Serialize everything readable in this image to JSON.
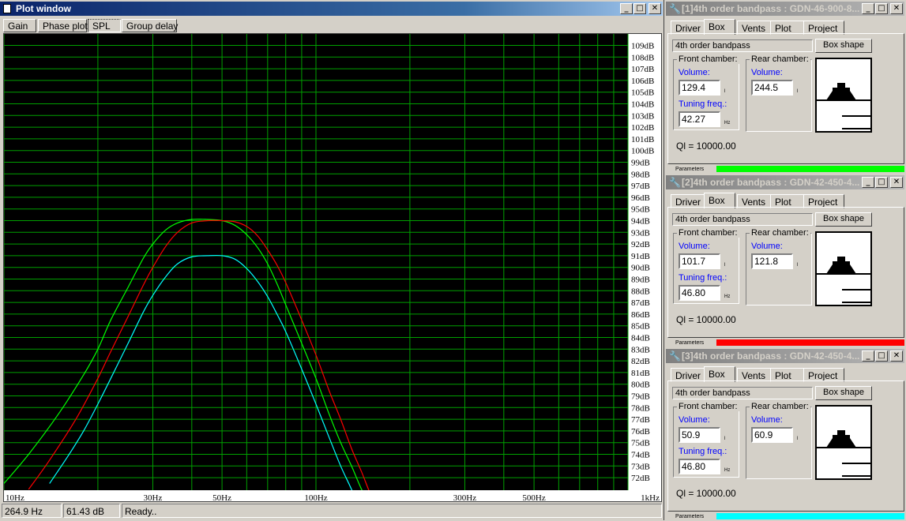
{
  "plot_window": {
    "title": "Plot window",
    "tabs": [
      "Gain",
      "Phase plot",
      "SPL",
      "Group delay"
    ],
    "selected_tab": 2,
    "status": {
      "frequency": "264.9 Hz",
      "level": "61.43 dB",
      "message": "Ready.."
    }
  },
  "chart_data": {
    "type": "line",
    "xscale": "log",
    "xlim": [
      10,
      1000
    ],
    "ylim": [
      71,
      110
    ],
    "x_tick_labels": [
      {
        "value": 10,
        "label": "10Hz"
      },
      {
        "value": 30,
        "label": "30Hz"
      },
      {
        "value": 50,
        "label": "50Hz"
      },
      {
        "value": 100,
        "label": "100Hz"
      },
      {
        "value": 300,
        "label": "300Hz"
      },
      {
        "value": 500,
        "label": "500Hz"
      },
      {
        "value": 1000,
        "label": "1kHz"
      }
    ],
    "x_grid": [
      10,
      20,
      30,
      40,
      50,
      60,
      70,
      80,
      90,
      100,
      200,
      300,
      400,
      500,
      600,
      700,
      800,
      900,
      1000
    ],
    "y_tick_labels": [
      "109dB",
      "108dB",
      "107dB",
      "106dB",
      "105dB",
      "104dB",
      "103dB",
      "102dB",
      "101dB",
      "100dB",
      "99dB",
      "98dB",
      "97dB",
      "96dB",
      "95dB",
      "94dB",
      "93dB",
      "92dB",
      "91dB",
      "90dB",
      "89dB",
      "88dB",
      "87dB",
      "86dB",
      "85dB",
      "84dB",
      "83dB",
      "82dB",
      "81dB",
      "80dB",
      "79dB",
      "78dB",
      "77dB",
      "76dB",
      "75dB",
      "74dB",
      "73dB",
      "72dB"
    ],
    "y_tick_values": [
      109,
      108,
      107,
      106,
      105,
      104,
      103,
      102,
      101,
      100,
      99,
      98,
      97,
      96,
      95,
      94,
      93,
      92,
      91,
      90,
      89,
      88,
      87,
      86,
      85,
      84,
      83,
      82,
      81,
      80,
      79,
      78,
      77,
      76,
      75,
      74,
      73,
      72
    ],
    "grid": true,
    "colors": {
      "background": "#000000",
      "grid": "#00a000",
      "labels": "#000000"
    },
    "series": [
      {
        "color": "#00ff00",
        "x": [
          10,
          12,
          15,
          18,
          20,
          22,
          25,
          28,
          30,
          33,
          36,
          40,
          45,
          50,
          55,
          60,
          65,
          70,
          75,
          80,
          90,
          100,
          110,
          120,
          130,
          140,
          150
        ],
        "y": [
          71.5,
          74.0,
          77.5,
          80.8,
          83.0,
          85.5,
          88.3,
          90.8,
          92.0,
          93.2,
          93.8,
          94.1,
          94.1,
          94.0,
          93.6,
          92.8,
          91.7,
          90.3,
          88.6,
          86.8,
          83.5,
          80.5,
          77.5,
          75.0,
          73.0,
          71.0,
          69.5
        ]
      },
      {
        "color": "#ff0000",
        "x": [
          12,
          14,
          17,
          20,
          22,
          25,
          28,
          30,
          33,
          36,
          40,
          45,
          50,
          55,
          60,
          65,
          70,
          75,
          80,
          90,
          100,
          110,
          120,
          130,
          140,
          150,
          160
        ],
        "y": [
          71.0,
          73.5,
          77.0,
          80.5,
          82.8,
          85.8,
          88.5,
          90.0,
          91.8,
          93.0,
          93.8,
          94.0,
          94.0,
          93.9,
          93.5,
          92.7,
          91.5,
          90.2,
          88.7,
          85.5,
          82.5,
          79.5,
          77.0,
          74.5,
          72.5,
          70.5,
          69.0
        ]
      },
      {
        "color": "#00ffff",
        "x": [
          14,
          16,
          18,
          20,
          22,
          25,
          28,
          30,
          33,
          36,
          40,
          45,
          50,
          55,
          60,
          65,
          70,
          75,
          80,
          90,
          100,
          110,
          120,
          130,
          140
        ],
        "y": [
          71.5,
          73.8,
          76.0,
          78.3,
          80.5,
          83.5,
          86.2,
          87.6,
          89.2,
          90.3,
          90.9,
          91.0,
          91.0,
          90.7,
          89.9,
          88.8,
          87.5,
          86.0,
          84.5,
          81.3,
          78.3,
          75.5,
          73.0,
          71.0,
          69.0
        ]
      }
    ]
  },
  "panels": [
    {
      "title": "[1]4th order bandpass : GDN-46-900-8...",
      "tabs": [
        "Driver",
        "Box",
        "Vents",
        "Plot",
        "Project"
      ],
      "selected_tab": 1,
      "box_type": "4th order bandpass",
      "box_shape_button": "Box shape",
      "front_label": "Front chamber:",
      "rear_label": "Rear chamber:",
      "volume_label": "Volume:",
      "tuning_label": "Tuning freq.:",
      "front_volume": "129.4",
      "front_volume_unit": "l",
      "rear_volume": "244.5",
      "rear_volume_unit": "l",
      "tuning": "42.27",
      "tuning_unit": "Hz",
      "ql": "Ql = 10000.00",
      "parameters_label": "Parameters",
      "color": "#00ff00"
    },
    {
      "title": "[2]4th order bandpass : GDN-42-450-4...",
      "tabs": [
        "Driver",
        "Box",
        "Vents",
        "Plot",
        "Project"
      ],
      "selected_tab": 1,
      "box_type": "4th order bandpass",
      "box_shape_button": "Box shape",
      "front_label": "Front chamber:",
      "rear_label": "Rear chamber:",
      "volume_label": "Volume:",
      "tuning_label": "Tuning freq.:",
      "front_volume": "101.7",
      "front_volume_unit": "l",
      "rear_volume": "121.8",
      "rear_volume_unit": "l",
      "tuning": "46.80",
      "tuning_unit": "Hz",
      "ql": "Ql = 10000.00",
      "parameters_label": "Parameters",
      "color": "#ff0000"
    },
    {
      "title": "[3]4th order bandpass : GDN-42-450-4...",
      "tabs": [
        "Driver",
        "Box",
        "Vents",
        "Plot",
        "Project"
      ],
      "selected_tab": 1,
      "box_type": "4th order bandpass",
      "box_shape_button": "Box shape",
      "front_label": "Front chamber:",
      "rear_label": "Rear chamber:",
      "volume_label": "Volume:",
      "tuning_label": "Tuning freq.:",
      "front_volume": "50.9",
      "front_volume_unit": "l",
      "rear_volume": "60.9",
      "rear_volume_unit": "l",
      "tuning": "46.80",
      "tuning_unit": "Hz",
      "ql": "Ql = 10000.00",
      "parameters_label": "Parameters",
      "color": "#00ffff"
    }
  ],
  "window_buttons": {
    "minimize": "_",
    "maximize": "□",
    "close": "✕"
  }
}
